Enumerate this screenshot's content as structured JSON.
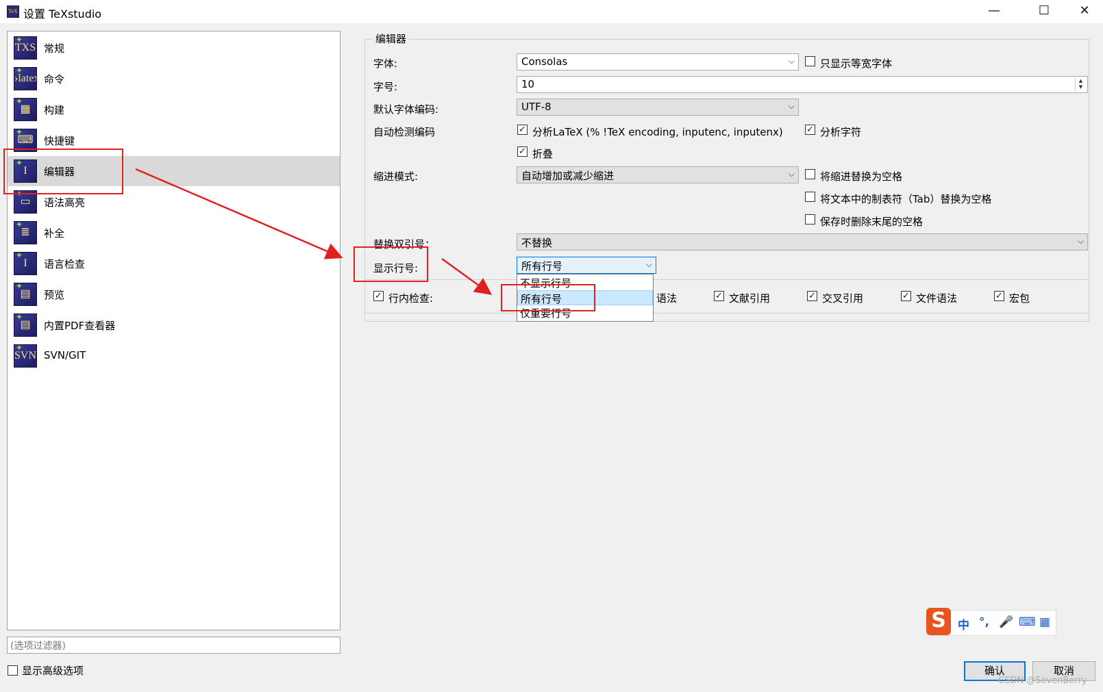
{
  "window": {
    "app_icon": "TeX",
    "title": "设置 TeXstudio",
    "controls": {
      "minimize": "—",
      "maximize": "☐",
      "close": "✕"
    }
  },
  "sidebar": {
    "items": [
      {
        "label": "常规",
        "icon": "general-icon",
        "glyph": "TXS"
      },
      {
        "label": "命令",
        "icon": "commands-icon",
        "glyph": "›latex"
      },
      {
        "label": "构建",
        "icon": "build-icon",
        "glyph": "▦"
      },
      {
        "label": "快捷键",
        "icon": "keyboard-icon",
        "glyph": "⌨"
      },
      {
        "label": "编辑器",
        "icon": "editor-icon",
        "glyph": "I",
        "selected": true
      },
      {
        "label": "语法高亮",
        "icon": "syntax-highlight-icon",
        "glyph": "▭"
      },
      {
        "label": "补全",
        "icon": "completion-icon",
        "glyph": "≣"
      },
      {
        "label": "语言检查",
        "icon": "language-check-icon",
        "glyph": "I"
      },
      {
        "label": "预览",
        "icon": "preview-icon",
        "glyph": "▤"
      },
      {
        "label": "内置PDF查看器",
        "icon": "pdf-viewer-icon",
        "glyph": "▤"
      },
      {
        "label": "SVN/GIT",
        "icon": "svn-git-icon",
        "glyph": "SVN"
      }
    ],
    "filter_placeholder": "(选项过滤器)",
    "show_advanced_label": "显示高级选项",
    "show_advanced_checked": false
  },
  "editor": {
    "group_title": "编辑器",
    "font_label": "字体:",
    "font_value": "Consolas",
    "monospace_only_label": "只显示等宽字体",
    "monospace_only_checked": false,
    "font_size_label": "字号:",
    "font_size_value": "10",
    "spin_up": "▲",
    "spin_down": "▼",
    "encoding_label": "默认字体编码:",
    "encoding_value": "UTF-8",
    "auto_detect_label": "自动检测编码",
    "analyze_latex_label": "分析LaTeX (% !TeX encoding, inputenc, inputenx)",
    "analyze_latex_checked": true,
    "analyze_chars_label": "分析字符",
    "analyze_chars_checked": true,
    "folding_label": "折叠",
    "folding_checked": true,
    "indent_mode_label": "缩进模式:",
    "indent_mode_value": "自动增加或减少缩进",
    "replace_indent_label": "将缩进替换为空格",
    "replace_indent_checked": false,
    "replace_tab_label": "将文本中的制表符（Tab）替换为空格",
    "replace_tab_checked": false,
    "trim_trailing_label": "保存时删除末尾的空格",
    "trim_trailing_checked": false,
    "replace_quotes_label": "替换双引号：",
    "replace_quotes_value": "不替换",
    "line_numbers_label": "显示行号:",
    "line_numbers_value": "所有行号",
    "line_numbers_options": [
      "不显示行号",
      "所有行号",
      "仅重要行号"
    ],
    "line_numbers_highlighted": "所有行号",
    "inline_check_label": "行内检查:",
    "inline_check_checked": true,
    "inline_syntax_label": "语法",
    "inline_options": [
      {
        "label": "文献引用",
        "checked": true
      },
      {
        "label": "交叉引用",
        "checked": true
      },
      {
        "label": "文件语法",
        "checked": true
      },
      {
        "label": "宏包",
        "checked": true
      }
    ]
  },
  "buttons": {
    "ok": "确认",
    "cancel": "取消"
  },
  "ime_toolbar": {
    "logo": "S",
    "items": [
      "中",
      "°,",
      "🎤",
      "⌨",
      "▦"
    ]
  },
  "watermark": "CSDN @SevenBerry",
  "annotation_color": "#e02020",
  "accent_color": "#0078d7",
  "checkmark": "✓"
}
